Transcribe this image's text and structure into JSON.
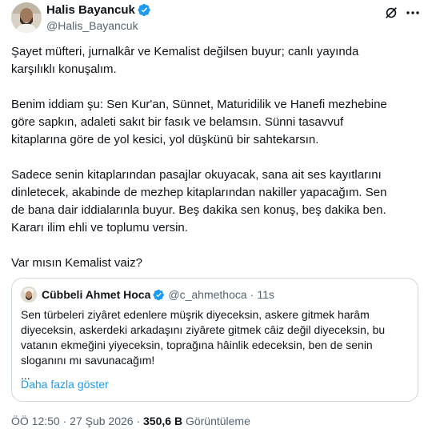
{
  "author": {
    "name": "Halis Bayancuk",
    "handle": "@Halis_Bayancuk"
  },
  "tweet": {
    "paragraphs": [
      [
        "Şayet müfteri, jurnalkâr ve Kemalist değilsen buyur; canlı yayında",
        "karşılıklı konuşalım."
      ],
      [
        "Benim iddiam şu: Sen Kur'an, Sünnet, Maturidilik ve Hanefi mezhebine",
        "göre sapkın, adaleti sakıt bir fasık ve belamsın. Sünni tasavvuf",
        "kitaplarına göre de yol kesici, yol düşkünü bir sahtekarsın."
      ],
      [
        "Sadece senin  kitaplarından pasajlar okuyacak, sana ait ses kayıtlarını",
        "dinletecek, akabinde de mezhep kitaplarından nakiller yapacağım. Sen",
        "de bana dair iddialarınla buyur. Beş dakika sen konuş, beş dakika ben.",
        "Kararı ilim ehli ve toplumu versin."
      ],
      [
        "Var mısın Kemalist vaiz?"
      ]
    ]
  },
  "quote": {
    "name": "Cübbeli Ahmet Hoca",
    "handle": "@c_ahmethoca",
    "separator": "·",
    "time": "11s",
    "lines": [
      "Sen türbeleri ziyâret edenlere müşrik diyeceksin, askere gitmek harâm",
      "diyeceksin, askerdeki arkadaşını ziyârete gitmek câiz değil diyeceksin, bu",
      "vatanın ekmeğini yiyeceksin, toprağına hâinlik edeceksin, ben de senin",
      "sloganını mı savunacağım!",
      "..."
    ],
    "show_more": "Daha fazla göster"
  },
  "footer": {
    "time": "ÖÖ 12:50",
    "dot1": "·",
    "date": "27 Şub 2026",
    "dot2": "·",
    "views_count": "350,6 B",
    "views_label": "Görüntüleme"
  },
  "colors": {
    "verified": "#1d9bf0",
    "link": "#1d9bf0",
    "secondary_text": "#536471"
  },
  "icons": {
    "verified": "verified-badge-icon",
    "grok": "grok-icon",
    "more": "more-horizontal-icon"
  }
}
